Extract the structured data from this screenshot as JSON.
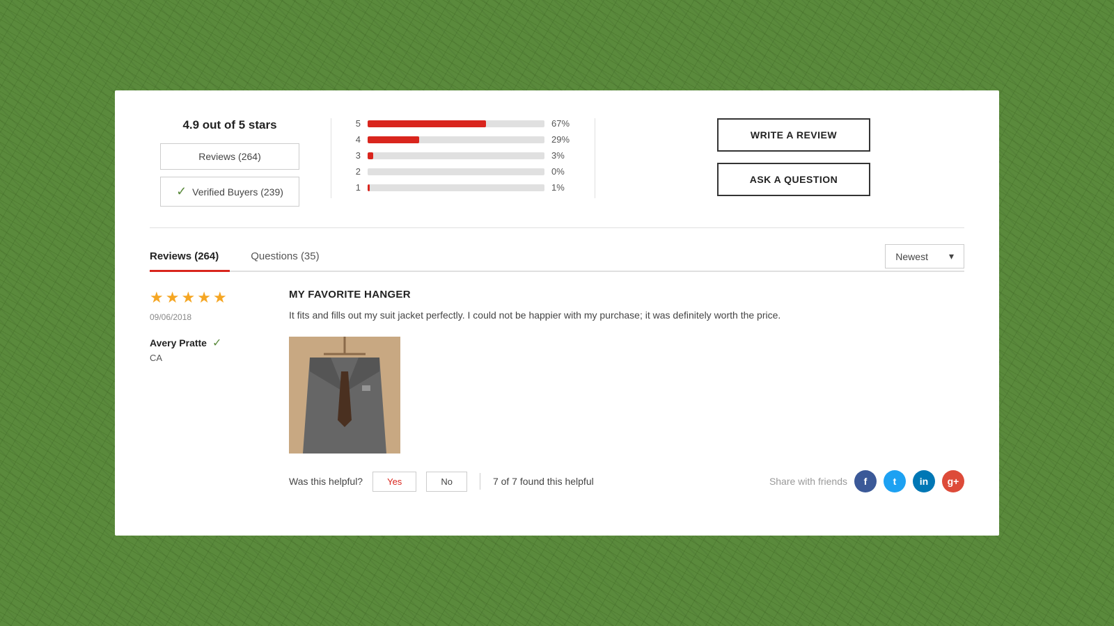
{
  "page": {
    "background_color": "#5a8a3c"
  },
  "rating_block": {
    "score_text": "4.9 out of 5 stars",
    "reviews_label": "Reviews (264)",
    "verified_label": "Verified Buyers (239)"
  },
  "bars": [
    {
      "label": "5",
      "pct": 67,
      "pct_text": "67%"
    },
    {
      "label": "4",
      "pct": 29,
      "pct_text": "29%"
    },
    {
      "label": "3",
      "pct": 3,
      "pct_text": "3%"
    },
    {
      "label": "2",
      "pct": 0,
      "pct_text": "0%"
    },
    {
      "label": "1",
      "pct": 1,
      "pct_text": "1%"
    }
  ],
  "actions": {
    "write_review": "WRITE A REVIEW",
    "ask_question": "ASK A QUESTION"
  },
  "tabs": [
    {
      "label": "Reviews (264)",
      "active": true
    },
    {
      "label": "Questions (35)",
      "active": false
    }
  ],
  "sort": {
    "label": "Newest",
    "chevron": "▾"
  },
  "review": {
    "stars": 5,
    "date": "09/06/2018",
    "reviewer_name": "Avery Pratte",
    "reviewer_location": "CA",
    "title": "MY FAVORITE HANGER",
    "text": "It fits and fills out my suit jacket perfectly. I could not be happier with my purchase; it was definitely worth the price.",
    "helpful_label": "Was this helpful?",
    "yes_label": "Yes",
    "no_label": "No",
    "helpful_count": "7 of 7 found this helpful",
    "share_label": "Share with friends"
  }
}
